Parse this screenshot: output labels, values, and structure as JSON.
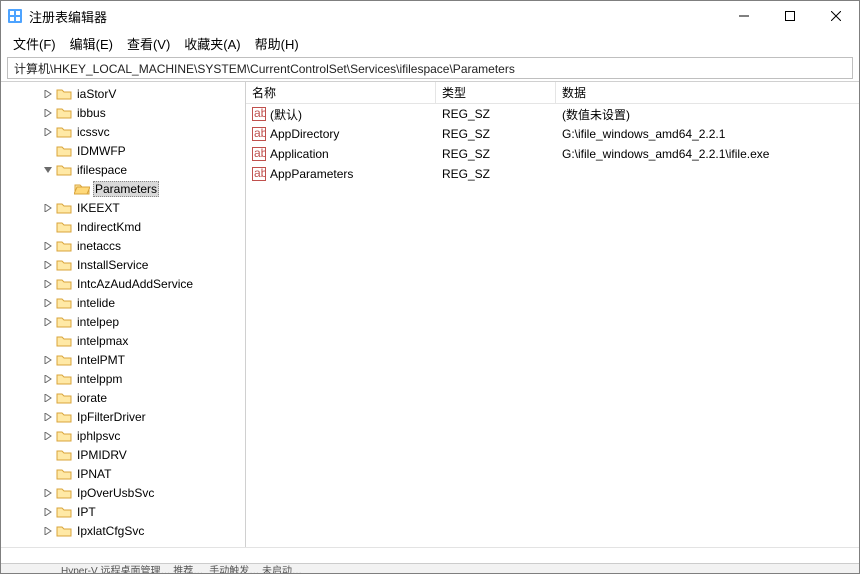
{
  "window": {
    "title": "注册表编辑器"
  },
  "menu": {
    "file": "文件(F)",
    "edit": "编辑(E)",
    "view": "查看(V)",
    "favorites": "收藏夹(A)",
    "help": "帮助(H)"
  },
  "address": "计算机\\HKEY_LOCAL_MACHINE\\SYSTEM\\CurrentControlSet\\Services\\ifilespace\\Parameters",
  "tree": [
    {
      "indent": 2,
      "expander": "closed",
      "label": "iaStorV"
    },
    {
      "indent": 2,
      "expander": "closed",
      "label": "ibbus"
    },
    {
      "indent": 2,
      "expander": "closed",
      "label": "icssvc"
    },
    {
      "indent": 2,
      "expander": "none",
      "label": "IDMWFP"
    },
    {
      "indent": 2,
      "expander": "open",
      "label": "ifilespace"
    },
    {
      "indent": 3,
      "expander": "none",
      "label": "Parameters",
      "selected": true
    },
    {
      "indent": 2,
      "expander": "closed",
      "label": "IKEEXT"
    },
    {
      "indent": 2,
      "expander": "none",
      "label": "IndirectKmd"
    },
    {
      "indent": 2,
      "expander": "closed",
      "label": "inetaccs"
    },
    {
      "indent": 2,
      "expander": "closed",
      "label": "InstallService"
    },
    {
      "indent": 2,
      "expander": "closed",
      "label": "IntcAzAudAddService"
    },
    {
      "indent": 2,
      "expander": "closed",
      "label": "intelide"
    },
    {
      "indent": 2,
      "expander": "closed",
      "label": "intelpep"
    },
    {
      "indent": 2,
      "expander": "none",
      "label": "intelpmax"
    },
    {
      "indent": 2,
      "expander": "closed",
      "label": "IntelPMT"
    },
    {
      "indent": 2,
      "expander": "closed",
      "label": "intelppm"
    },
    {
      "indent": 2,
      "expander": "closed",
      "label": "iorate"
    },
    {
      "indent": 2,
      "expander": "closed",
      "label": "IpFilterDriver"
    },
    {
      "indent": 2,
      "expander": "closed",
      "label": "iphlpsvc"
    },
    {
      "indent": 2,
      "expander": "none",
      "label": "IPMIDRV"
    },
    {
      "indent": 2,
      "expander": "none",
      "label": "IPNAT"
    },
    {
      "indent": 2,
      "expander": "closed",
      "label": "IpOverUsbSvc"
    },
    {
      "indent": 2,
      "expander": "closed",
      "label": "IPT"
    },
    {
      "indent": 2,
      "expander": "closed",
      "label": "IpxlatCfgSvc"
    }
  ],
  "list": {
    "headers": {
      "name": "名称",
      "type": "类型",
      "data": "数据"
    },
    "rows": [
      {
        "name": "(默认)",
        "type": "REG_SZ",
        "data": "(数值未设置)"
      },
      {
        "name": "AppDirectory",
        "type": "REG_SZ",
        "data": "G:\\ifile_windows_amd64_2.2.1"
      },
      {
        "name": "Application",
        "type": "REG_SZ",
        "data": "G:\\ifile_windows_amd64_2.2.1\\ifile.exe"
      },
      {
        "name": "AppParameters",
        "type": "REG_SZ",
        "data": ""
      }
    ]
  },
  "taskbar": {
    "item1": "Hyper-V 远程桌面管理…  推荐…",
    "item2": "手动触发…  未启动…"
  }
}
